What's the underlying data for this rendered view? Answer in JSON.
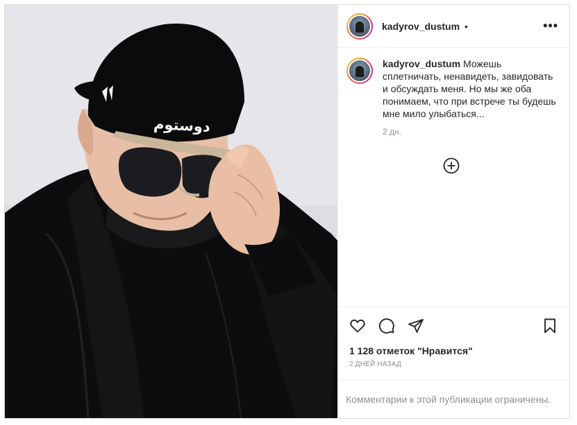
{
  "post": {
    "username": "kadyrov_dustum",
    "separator": "•",
    "more_glyph": "•••",
    "cap_text": "دوستوم",
    "caption": "Можешь сплетничать, ненавидеть, завидовать и обсуждать меня. Но мы же оба понимаем, что при встрече ты будешь мне мило улыбаться...",
    "caption_time": "2 дн.",
    "likes": "1 128 отметок \"Нравится\"",
    "date": "2 ДНЕЙ НАЗАД",
    "comments_notice": "Комментарии к этой публикации ограничены."
  },
  "icons": {
    "more": "more-horizontal-icon",
    "load_more": "plus-circle-icon",
    "like": "heart-icon",
    "comment": "comment-bubble-icon",
    "share": "paper-plane-icon",
    "save": "bookmark-icon"
  },
  "colors": {
    "text": "#262626",
    "secondary": "#8e8e8e",
    "border": "#dbdbdb",
    "ring_start": "#f9a826",
    "ring_end": "#c13584"
  }
}
